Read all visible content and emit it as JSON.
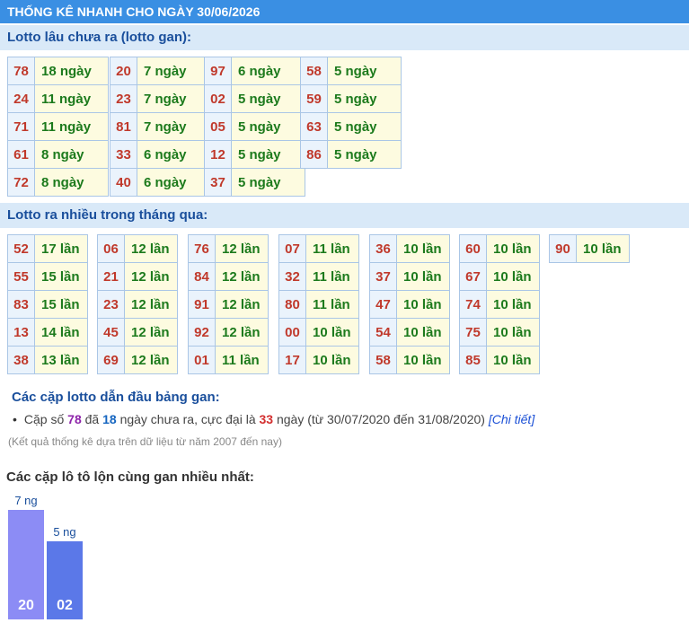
{
  "header": {
    "title": "THỐNG KÊ NHANH CHO NGÀY 30/06/2026"
  },
  "gan": {
    "title": "Lotto lâu chưa ra (lotto gan):",
    "columns": [
      [
        {
          "num": "78",
          "val": "18 ngày"
        },
        {
          "num": "24",
          "val": "11 ngày"
        },
        {
          "num": "71",
          "val": "11 ngày"
        },
        {
          "num": "61",
          "val": "8 ngày"
        },
        {
          "num": "72",
          "val": "8 ngày"
        }
      ],
      [
        {
          "num": "20",
          "val": "7 ngày"
        },
        {
          "num": "23",
          "val": "7 ngày"
        },
        {
          "num": "81",
          "val": "7 ngày"
        },
        {
          "num": "33",
          "val": "6 ngày"
        },
        {
          "num": "40",
          "val": "6 ngày"
        }
      ],
      [
        {
          "num": "97",
          "val": "6 ngày"
        },
        {
          "num": "02",
          "val": "5 ngày"
        },
        {
          "num": "05",
          "val": "5 ngày"
        },
        {
          "num": "12",
          "val": "5 ngày"
        },
        {
          "num": "37",
          "val": "5 ngày"
        }
      ],
      [
        {
          "num": "58",
          "val": "5 ngày"
        },
        {
          "num": "59",
          "val": "5 ngày"
        },
        {
          "num": "63",
          "val": "5 ngày"
        },
        {
          "num": "86",
          "val": "5 ngày"
        }
      ]
    ]
  },
  "nhieu": {
    "title": "Lotto ra nhiều trong tháng qua:",
    "columns": [
      [
        {
          "num": "52",
          "val": "17 lần"
        },
        {
          "num": "55",
          "val": "15 lần"
        },
        {
          "num": "83",
          "val": "15 lần"
        },
        {
          "num": "13",
          "val": "14 lần"
        },
        {
          "num": "38",
          "val": "13 lần"
        }
      ],
      [
        {
          "num": "06",
          "val": "12 lần"
        },
        {
          "num": "21",
          "val": "12 lần"
        },
        {
          "num": "23",
          "val": "12 lần"
        },
        {
          "num": "45",
          "val": "12 lần"
        },
        {
          "num": "69",
          "val": "12 lần"
        }
      ],
      [
        {
          "num": "76",
          "val": "12 lần"
        },
        {
          "num": "84",
          "val": "12 lần"
        },
        {
          "num": "91",
          "val": "12 lần"
        },
        {
          "num": "92",
          "val": "12 lần"
        },
        {
          "num": "01",
          "val": "11 lần"
        }
      ],
      [
        {
          "num": "07",
          "val": "11 lần"
        },
        {
          "num": "32",
          "val": "11 lần"
        },
        {
          "num": "80",
          "val": "11 lần"
        },
        {
          "num": "00",
          "val": "10 lần"
        },
        {
          "num": "17",
          "val": "10 lần"
        }
      ],
      [
        {
          "num": "36",
          "val": "10 lần"
        },
        {
          "num": "37",
          "val": "10 lần"
        },
        {
          "num": "47",
          "val": "10 lần"
        },
        {
          "num": "54",
          "val": "10 lần"
        },
        {
          "num": "58",
          "val": "10 lần"
        }
      ],
      [
        {
          "num": "60",
          "val": "10 lần"
        },
        {
          "num": "67",
          "val": "10 lần"
        },
        {
          "num": "74",
          "val": "10 lần"
        },
        {
          "num": "75",
          "val": "10 lần"
        },
        {
          "num": "85",
          "val": "10 lần"
        }
      ],
      [
        {
          "num": "90",
          "val": "10 lần"
        }
      ]
    ]
  },
  "pairs": {
    "title": "Các cặp lotto dẫn đầu bảng gan:",
    "line_prefix": "Cặp số",
    "pair_num": "78",
    "line_mid1": "đã",
    "days": "18",
    "line_mid2": "ngày chưa ra, cực đại là",
    "max_days": "33",
    "line_suffix": "ngày (từ 30/07/2020 đến 31/08/2020)",
    "link_text": "[Chi tiết]",
    "note": "(Kết quả thống kê dựa trên dữ liệu từ năm 2007 đến nay)"
  },
  "lon": {
    "title": "Các cặp lô tô lộn cùng gan nhiều nhất:"
  },
  "chart_data": {
    "type": "bar",
    "categories": [
      "20",
      "02"
    ],
    "values": [
      7,
      5
    ],
    "value_labels": [
      "7 ng",
      "5 ng"
    ],
    "colors": [
      "#8c8cf5",
      "#5b78e8"
    ]
  },
  "colors": {
    "header_bg": "#3a8fe3",
    "section_bg": "#d9e9f8",
    "num_text": "#c0392b",
    "val_text": "#1c7a1c"
  }
}
